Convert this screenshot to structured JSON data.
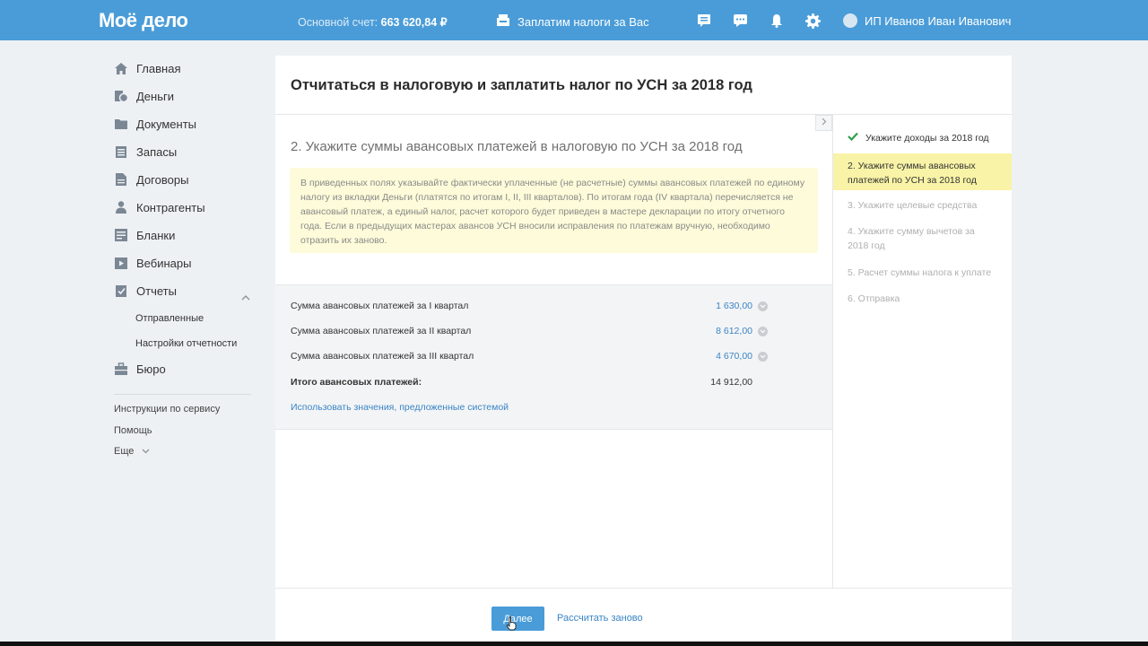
{
  "header": {
    "logo": "Моё дело",
    "balance_label": "Основной счет:",
    "balance_value": "663 620,84 ₽",
    "tax_service": "Заплатим налоги за Вас",
    "user_name": "ИП Иванов Иван Иванович"
  },
  "sidebar": {
    "items": [
      {
        "label": "Главная",
        "icon": "home-icon"
      },
      {
        "label": "Деньги",
        "icon": "money-icon"
      },
      {
        "label": "Документы",
        "icon": "folder-icon"
      },
      {
        "label": "Запасы",
        "icon": "stock-icon"
      },
      {
        "label": "Договоры",
        "icon": "contract-icon"
      },
      {
        "label": "Контрагенты",
        "icon": "contractors-icon"
      },
      {
        "label": "Бланки",
        "icon": "forms-icon"
      },
      {
        "label": "Вебинары",
        "icon": "webinar-icon"
      },
      {
        "label": "Отчеты",
        "icon": "reports-icon"
      },
      {
        "label": "Бюро",
        "icon": "briefcase-icon"
      }
    ],
    "reports_sub": [
      "Отправленные",
      "Настройки отчетности"
    ],
    "footer": [
      "Инструкции по сервису",
      "Помощь",
      "Еще"
    ]
  },
  "main": {
    "title": "Отчитаться в налоговую и заплатить налог по УСН за 2018 год",
    "step_title": "2. Укажите суммы авансовых платежей в налоговую по УСН за 2018 год",
    "note": "В приведенных полях указывайте фактически уплаченные (не расчетные) суммы авансовых платежей по единому налогу из вкладки Деньги (платятся по итогам I, II, III кварталов). По итогам года (IV квартала) перечисляется не авансовый платеж, а единый налог, расчет которого будет приведен в мастере декларации по итогу отчетного года. Если в предыдущих мастерах авансов УСН вносили исправления по платежам вручную, необходимо отразить их заново.",
    "rows": [
      {
        "label": "Сумма авансовых платежей за I квартал",
        "value": "1 630,00"
      },
      {
        "label": "Сумма авансовых платежей за II квартал",
        "value": "8 612,00"
      },
      {
        "label": "Сумма авансовых платежей за III квартал",
        "value": "4 670,00"
      }
    ],
    "total_label": "Итого авансовых платежей:",
    "total_value": "14 912,00",
    "suggest_link": "Использовать значения, предложенные системой",
    "next_button": "Далее",
    "recalc_link": "Рассчитать заново"
  },
  "steps": [
    "Укажите доходы за 2018 год",
    "2.   Укажите суммы авансовых платежей по УСН за 2018 год",
    "3.   Укажите целевые средства",
    "4.   Укажите сумму вычетов за 2018 год",
    "5.   Расчет суммы налога к уплате",
    "6.   Отправка"
  ]
}
